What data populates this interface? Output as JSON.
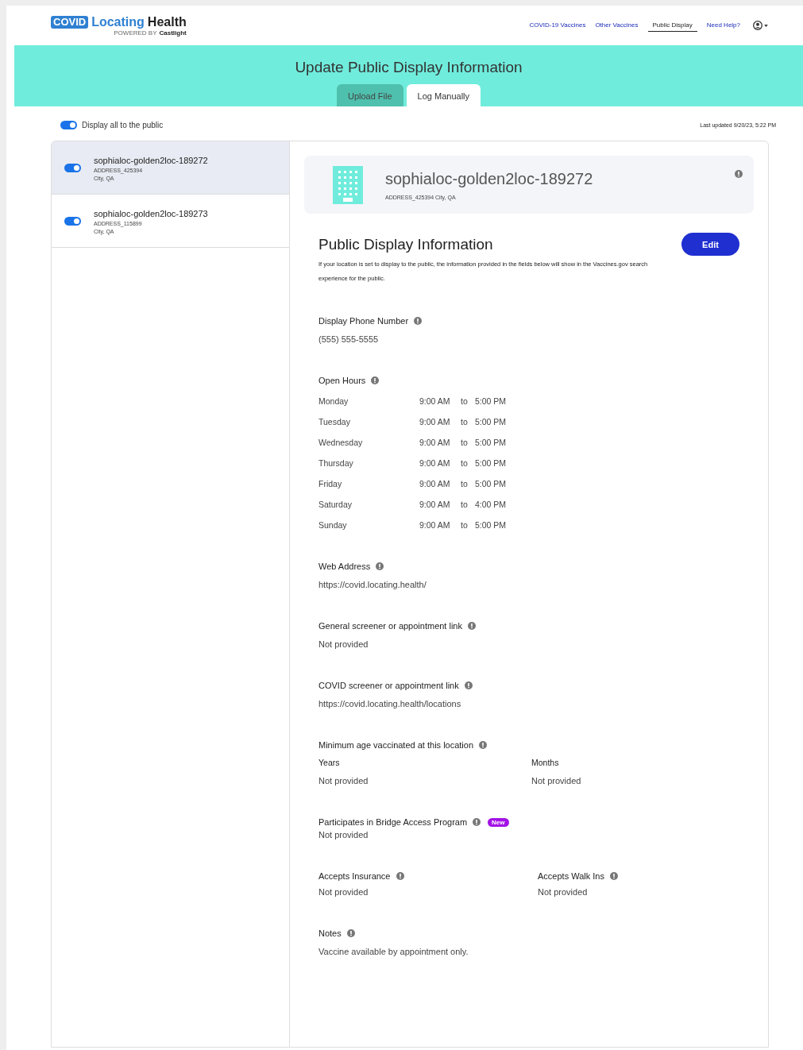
{
  "header": {
    "logo": {
      "badge": "COVID",
      "word1": "Locating",
      "word2": "Health",
      "powered_by": "POWERED BY",
      "brand": "Castlight"
    },
    "nav": [
      {
        "label": "COVID-19 Vaccines",
        "selected": false
      },
      {
        "label": "Other Vaccines",
        "selected": false
      },
      {
        "label": "Public Display",
        "selected": true
      },
      {
        "label": "Need Help?",
        "selected": false
      }
    ]
  },
  "banner": {
    "title": "Update Public Display Information",
    "tabs": [
      {
        "label": "Upload File",
        "selected": false
      },
      {
        "label": "Log Manually",
        "selected": true
      }
    ]
  },
  "display_all": {
    "label": "Display all to the public",
    "on": true
  },
  "last_updated": "Last updated 9/20/23, 5:22 PM",
  "locations": [
    {
      "name": "sophialoc-golden2loc-189272",
      "address": "ADDRESS_425394",
      "city": "City, QA",
      "on": true,
      "selected": true
    },
    {
      "name": "sophialoc-golden2loc-189273",
      "address": "ADDRESS_115899",
      "city": "City, QA",
      "on": true,
      "selected": false
    }
  ],
  "detail": {
    "name": "sophialoc-golden2loc-189272",
    "address": "ADDRESS_425394 City, QA",
    "section_title": "Public Display Information",
    "edit_button": "Edit",
    "description": "If your location is set to display to the public, the information provided in the fields below will show in the Vaccines.gov search experience for the public.",
    "fields": [
      {
        "kind": "single",
        "label": "Display Phone Number",
        "value": "(555) 555-5555"
      },
      {
        "kind": "hours",
        "label": "Open Hours",
        "rows": [
          {
            "day": "Monday",
            "open": "9:00 AM",
            "to": "to",
            "close": "5:00 PM"
          },
          {
            "day": "Tuesday",
            "open": "9:00 AM",
            "to": "to",
            "close": "5:00 PM"
          },
          {
            "day": "Wednesday",
            "open": "9:00 AM",
            "to": "to",
            "close": "5:00 PM"
          },
          {
            "day": "Thursday",
            "open": "9:00 AM",
            "to": "to",
            "close": "5:00 PM"
          },
          {
            "day": "Friday",
            "open": "9:00 AM",
            "to": "to",
            "close": "5:00 PM"
          },
          {
            "day": "Saturday",
            "open": "9:00 AM",
            "to": "to",
            "close": "4:00 PM"
          },
          {
            "day": "Sunday",
            "open": "9:00 AM",
            "to": "to",
            "close": "5:00 PM"
          }
        ]
      },
      {
        "kind": "single",
        "label": "Web Address",
        "value": "https://covid.locating.health/"
      },
      {
        "kind": "single",
        "label": "General screener or appointment link",
        "value": "Not provided"
      },
      {
        "kind": "single",
        "label": "COVID screener or appointment link",
        "value": "https://covid.locating.health/locations"
      },
      {
        "kind": "age",
        "label": "Minimum age vaccinated at this location",
        "columns": [
          {
            "label": "Years",
            "value": "Not provided"
          },
          {
            "label": "Months",
            "value": "Not provided"
          }
        ]
      },
      {
        "kind": "single",
        "label": "Participates in Bridge Access Program",
        "badge": "New",
        "value": "Not provided"
      },
      {
        "kind": "split",
        "items": [
          {
            "label": "Accepts Insurance",
            "value": "Not provided"
          },
          {
            "label": "Accepts Walk Ins",
            "value": "Not provided"
          }
        ]
      },
      {
        "kind": "single",
        "label": "Notes",
        "value": "Vaccine available by appointment only."
      }
    ]
  }
}
